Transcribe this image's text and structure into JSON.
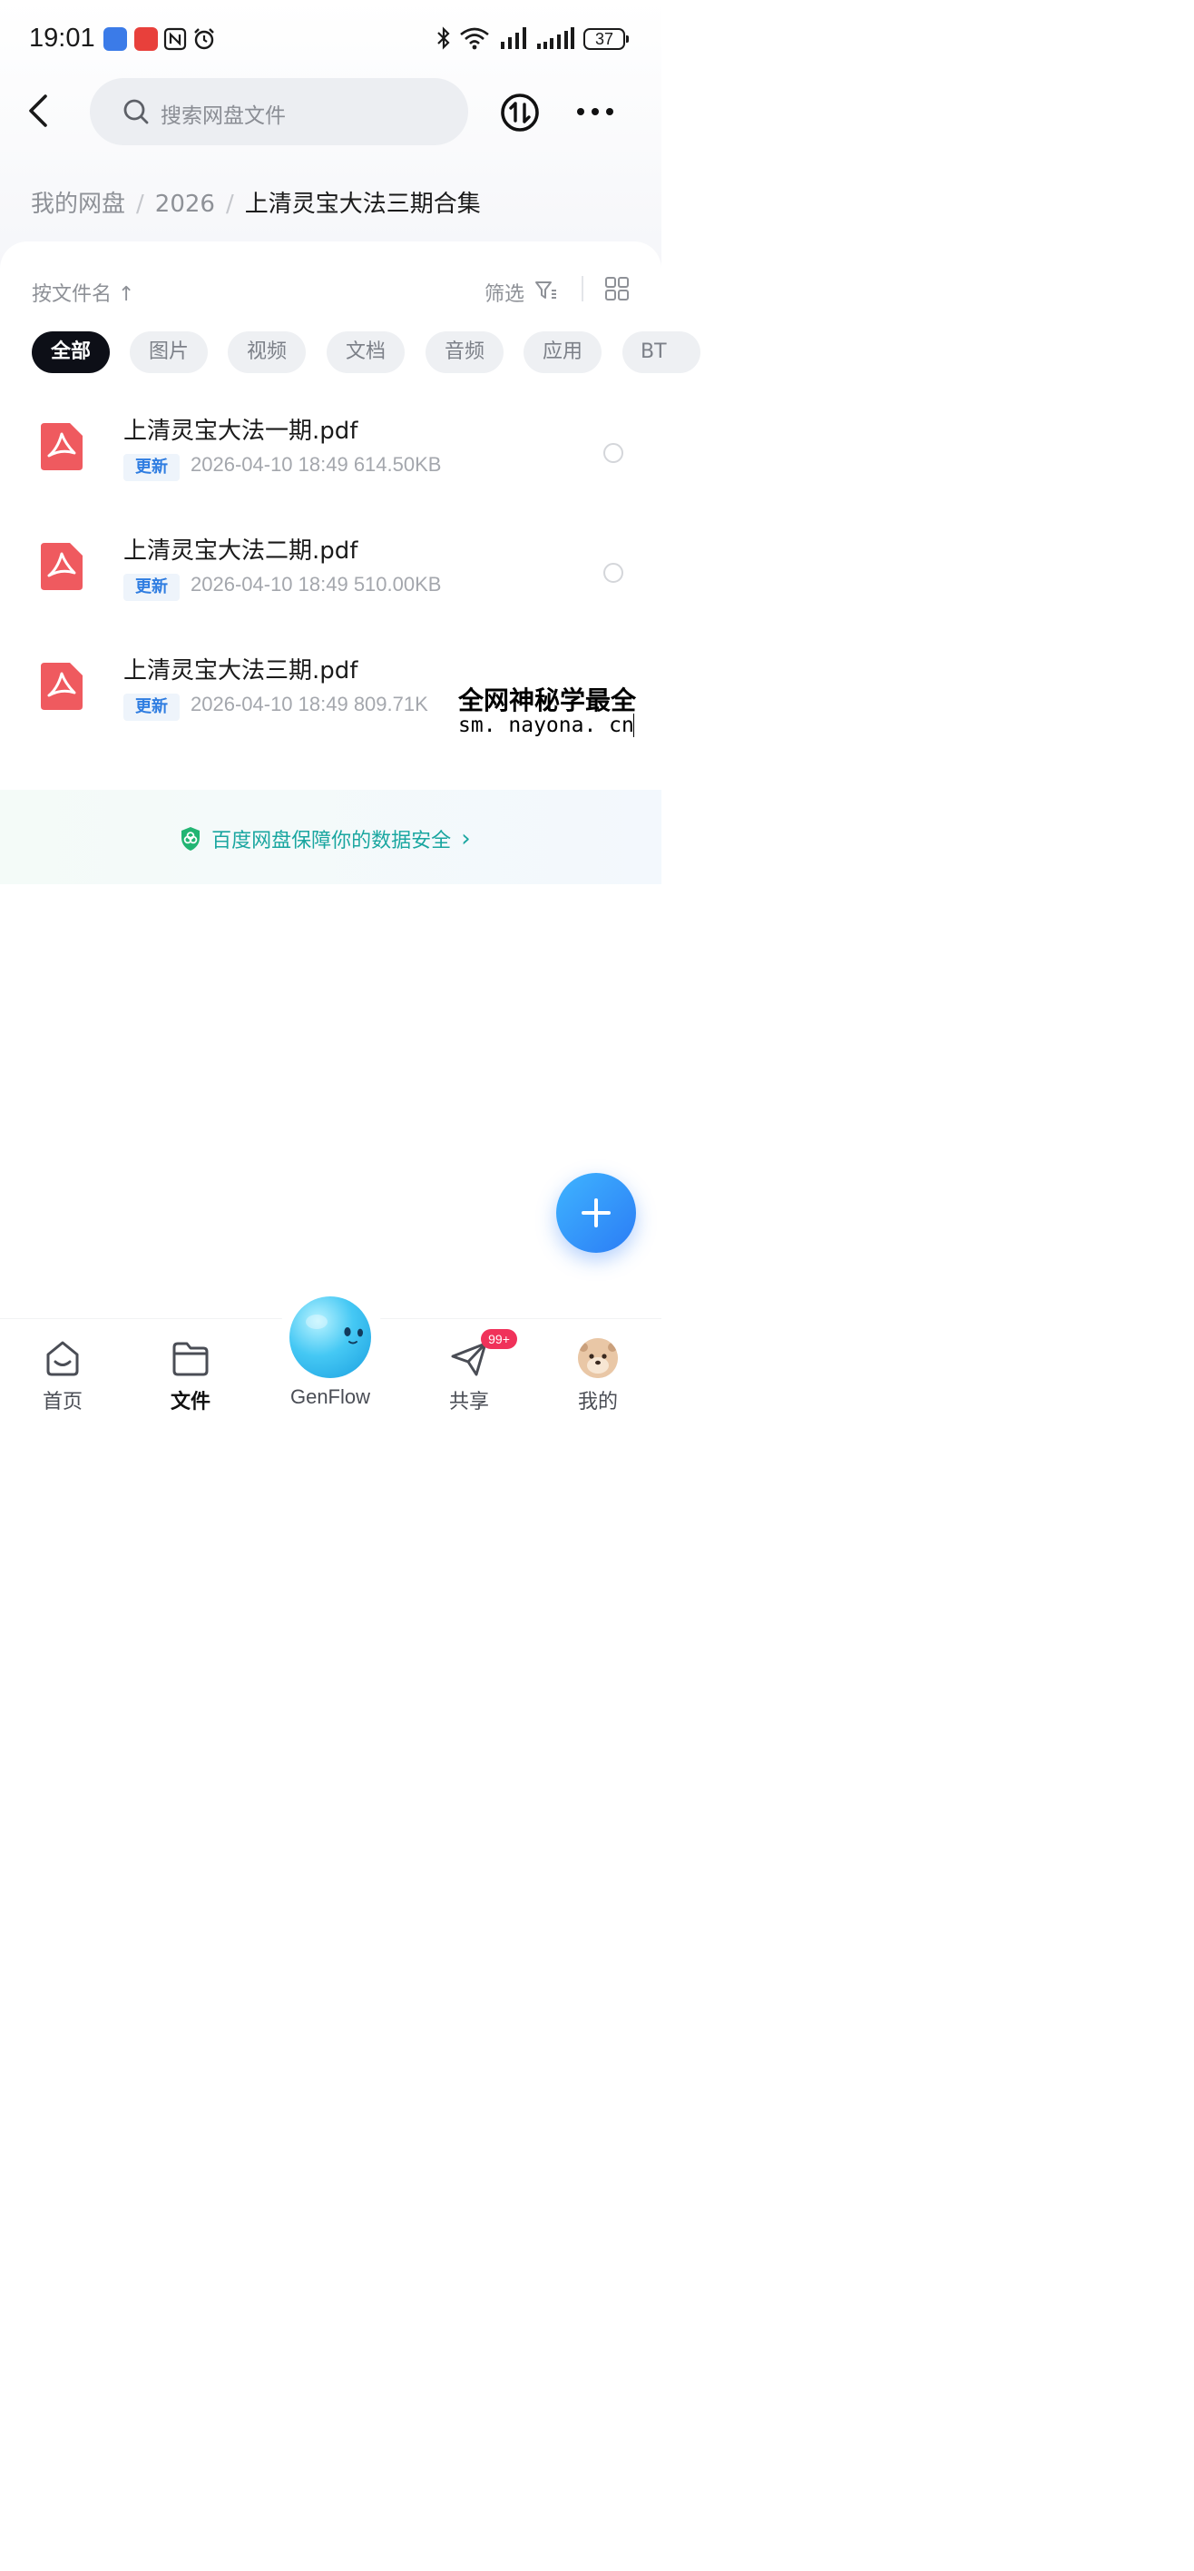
{
  "status_bar": {
    "time": "19:01",
    "battery": "37"
  },
  "header": {
    "search_placeholder": "搜索网盘文件"
  },
  "breadcrumb": {
    "items": [
      "我的网盘",
      "2026"
    ],
    "current": "上清灵宝大法三期合集"
  },
  "toolbar": {
    "sort_label": "按文件名 ↑",
    "filter_label": "筛选"
  },
  "chips": [
    "全部",
    "图片",
    "视频",
    "文档",
    "音频",
    "应用",
    "BT"
  ],
  "active_chip": "全部",
  "files": [
    {
      "name": "上清灵宝大法一期.pdf",
      "badge": "更新",
      "meta": "2026-04-10  18:49  614.50KB"
    },
    {
      "name": "上清灵宝大法二期.pdf",
      "badge": "更新",
      "meta": "2026-04-10  18:49  510.00KB"
    },
    {
      "name": "上清灵宝大法三期.pdf",
      "badge": "更新",
      "meta": "2026-04-10  18:49  809.71K"
    }
  ],
  "watermark": {
    "title": "全网神秘学最全",
    "url": "sm. nayona. cn"
  },
  "safety_banner": {
    "text": "百度网盘保障你的数据安全",
    "arrow": "›"
  },
  "bottom_nav": {
    "home": "首页",
    "files": "文件",
    "genflow": "GenFlow",
    "share": "共享",
    "share_badge": "99+",
    "mine": "我的"
  },
  "colors": {
    "accent": "#2b7cf5",
    "pdf_red": "#ef5a5f",
    "safety_green": "#1aa6a0",
    "badge_red": "#f0325a"
  },
  "icons": [
    "back-arrow-icon",
    "search-icon",
    "transfer-icon",
    "more-icon",
    "filter-icon",
    "grid-view-icon",
    "pdf-icon",
    "shield-icon",
    "plus-icon",
    "home-icon",
    "folder-icon",
    "genflow-icon",
    "share-icon",
    "avatar"
  ]
}
